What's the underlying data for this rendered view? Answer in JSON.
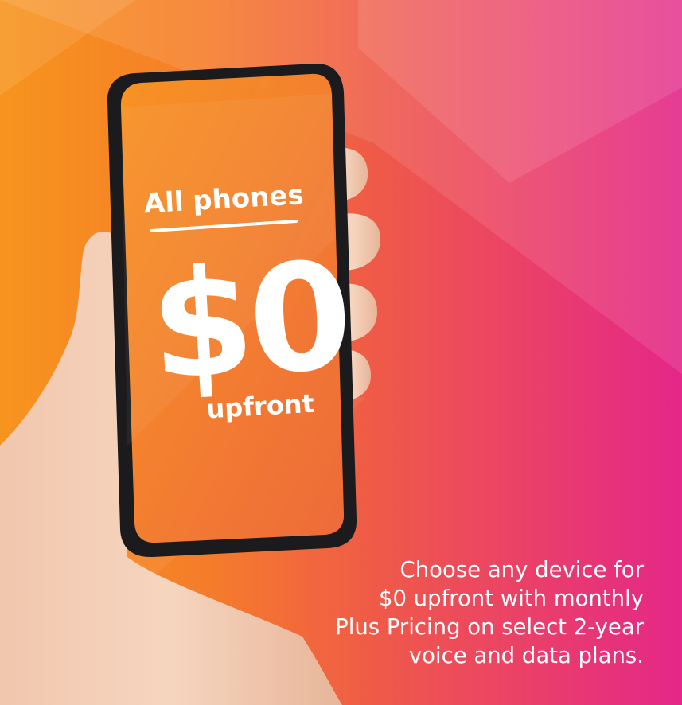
{
  "banner": {
    "phone_screen": {
      "heading": "All phones",
      "price": "$0",
      "subtext": "upfront"
    },
    "promo_lines": [
      "Choose any device for",
      "$0 upfront with monthly",
      "Plus Pricing on select 2-year",
      "voice and data plans."
    ]
  },
  "colors": {
    "gradient_left": "#f7941d",
    "gradient_mid": "#ef5a48",
    "gradient_right": "#e42788",
    "screen_orange": "#f07f2e",
    "phone_frame": "#1b1b1d",
    "text": "#ffffff"
  },
  "icons": {
    "hand": "hand-holding-phone-icon",
    "phone": "smartphone-icon"
  }
}
